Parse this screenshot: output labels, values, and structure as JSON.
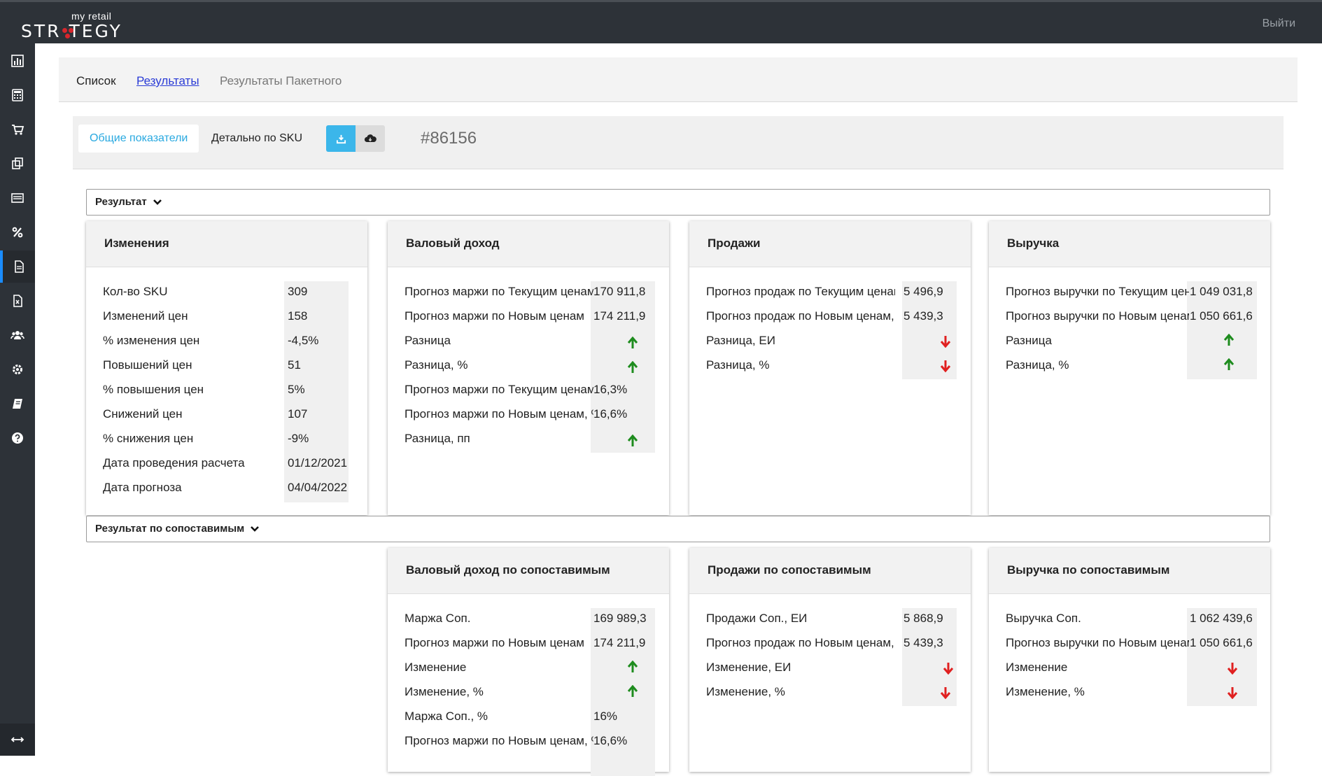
{
  "header": {
    "logo_small": "my retail",
    "logo_main": "STR   TEGY",
    "logout": "Выйти",
    "brand_color": "#d8262c"
  },
  "nav": {
    "list": "Список",
    "results": "Результаты",
    "batch_results": "Результаты Пакетного"
  },
  "toolbar": {
    "tab_general": "Общие показатели",
    "tab_sku": "Детально по SKU",
    "calc_id": "#86156"
  },
  "sections": {
    "result": "Результат",
    "result_comparable": "Результат по сопоставимым"
  },
  "cards": {
    "changes": {
      "title": "Изменения",
      "rows": [
        {
          "label": "Кол-во SKU",
          "value": "309"
        },
        {
          "label": "Изменений цен",
          "value": "158"
        },
        {
          "label": "% изменения цен",
          "value": "-4,5%"
        },
        {
          "label": "Повышений цен",
          "value": "51"
        },
        {
          "label": "% повышения цен",
          "value": "5%"
        },
        {
          "label": "Снижений цен",
          "value": "107"
        },
        {
          "label": "% снижения цен",
          "value": "-9%"
        },
        {
          "label": "Дата проведения расчета",
          "value": "01/12/2021"
        },
        {
          "label": "Дата прогноза",
          "value": "04/04/2022"
        }
      ]
    },
    "gross": {
      "title": "Валовый доход",
      "rows": [
        {
          "label": "Прогноз маржи по Текущим ценам",
          "value": "170 911,8"
        },
        {
          "label": "Прогноз маржи по Новым ценам",
          "value": "174 211,9"
        },
        {
          "label": "Разница",
          "arrow": "up"
        },
        {
          "label": "Разница, %",
          "arrow": "up"
        },
        {
          "label": "Прогноз маржи по Текущим ценам, %",
          "value": "16,3%"
        },
        {
          "label": "Прогноз маржи по Новым ценам, %",
          "value": "16,6%"
        },
        {
          "label": "Разница, пп",
          "arrow": "up"
        }
      ]
    },
    "sales": {
      "title": "Продажи",
      "rows": [
        {
          "label": "Прогноз продаж по Текущим ценам",
          "value": "5 496,9"
        },
        {
          "label": "Прогноз продаж по Новым ценам, ЕИ",
          "value": "5 439,3"
        },
        {
          "label": "Разница, ЕИ",
          "arrow": "down"
        },
        {
          "label": "Разница, %",
          "arrow": "down"
        }
      ]
    },
    "revenue": {
      "title": "Выручка",
      "rows": [
        {
          "label": "Прогноз выручки по Текущим ценам",
          "value": "1 049 031,8"
        },
        {
          "label": "Прогноз выручки по Новым ценам",
          "value": "1 050 661,6"
        },
        {
          "label": "Разница",
          "arrow": "up"
        },
        {
          "label": "Разница, %",
          "arrow": "up"
        }
      ]
    },
    "gross_comp": {
      "title": "Валовый доход по сопоставимым",
      "rows": [
        {
          "label": "Маржа Соп.",
          "value": "169 989,3"
        },
        {
          "label": "Прогноз маржи по Новым ценам",
          "value": "174 211,9"
        },
        {
          "label": "Изменение",
          "arrow": "up"
        },
        {
          "label": "Изменение, %",
          "arrow": "up"
        },
        {
          "label": "Маржа Соп., %",
          "value": "16%"
        },
        {
          "label": "Прогноз маржи по Новым ценам, %",
          "value": "16,6%"
        }
      ]
    },
    "sales_comp": {
      "title": "Продажи по сопоставимым",
      "rows": [
        {
          "label": "Продажи Соп., ЕИ",
          "value": "5 868,9"
        },
        {
          "label": "Прогноз продаж по Новым ценам, ЕИ",
          "value": "5 439,3"
        },
        {
          "label": "Изменение, ЕИ",
          "arrow": "down"
        },
        {
          "label": "Изменение, %",
          "arrow": "down"
        }
      ]
    },
    "revenue_comp": {
      "title": "Выручка по сопоставимым",
      "rows": [
        {
          "label": "Выручка Соп.",
          "value": "1 062 439,6"
        },
        {
          "label": "Прогноз выручки по Новым ценам",
          "value": "1 050 661,6"
        },
        {
          "label": "Изменение",
          "arrow": "down"
        },
        {
          "label": "Изменение, %",
          "arrow": "down"
        }
      ]
    }
  },
  "colors": {
    "arrow_up": "#1e8c1e",
    "arrow_down": "#e02020",
    "accent": "#29a9e0"
  }
}
